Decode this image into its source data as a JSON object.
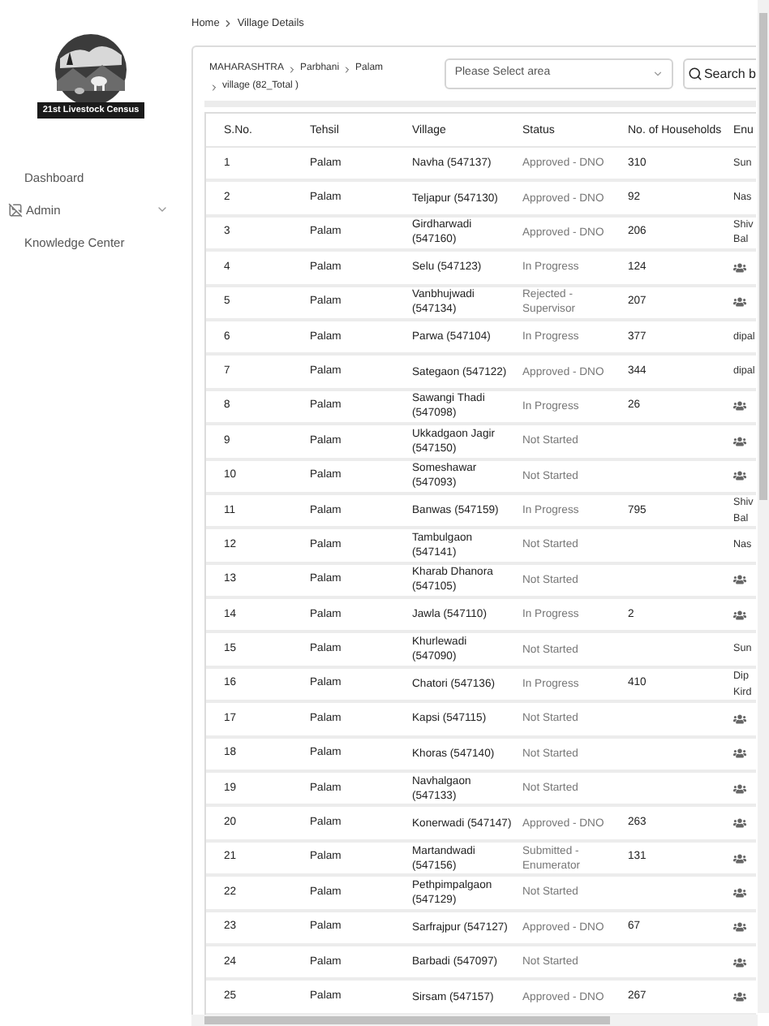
{
  "sidebar": {
    "logo_caption": "21st Livestock Census",
    "items": [
      {
        "label": "Dashboard",
        "kind": "plain",
        "selected": false
      },
      {
        "label": "Admin",
        "kind": "group",
        "selected": false,
        "expanded": false
      },
      {
        "label": "Knowledge Center",
        "kind": "plain",
        "selected": false
      }
    ]
  },
  "breadcrumb": [
    "Home",
    "Village Details"
  ],
  "location": {
    "path": [
      "MAHARASHTRA",
      "Parbhani",
      "Palam",
      "village (82_Total )"
    ]
  },
  "area_select": {
    "placeholder": "Please Select area"
  },
  "search_button": "Search b",
  "table": {
    "columns": [
      "S.No.",
      "Tehsil",
      "Village",
      "Status",
      "No. of Households",
      "Enu"
    ],
    "rows": [
      {
        "sno": "1",
        "tehsil": "Palam",
        "village": "Navha (547137)",
        "status": "Approved - DNO",
        "households": "310",
        "enumerator": {
          "kind": "text",
          "lines": [
            "Sun"
          ]
        }
      },
      {
        "sno": "2",
        "tehsil": "Palam",
        "village": "Teljapur (547130)",
        "status": "Approved - DNO",
        "households": "92",
        "enumerator": {
          "kind": "text",
          "lines": [
            "Nas"
          ]
        }
      },
      {
        "sno": "3",
        "tehsil": "Palam",
        "village": "Girdharwadi (547160)",
        "status": "Approved - DNO",
        "households": "206",
        "enumerator": {
          "kind": "text",
          "lines": [
            "Shiv",
            "Bal"
          ]
        }
      },
      {
        "sno": "4",
        "tehsil": "Palam",
        "village": "Selu (547123)",
        "status": "In Progress",
        "households": "124",
        "enumerator": {
          "kind": "icon"
        }
      },
      {
        "sno": "5",
        "tehsil": "Palam",
        "village": "Vanbhujwadi (547134)",
        "status": "Rejected - Supervisor",
        "households": "207",
        "enumerator": {
          "kind": "icon"
        }
      },
      {
        "sno": "6",
        "tehsil": "Palam",
        "village": "Parwa (547104)",
        "status": "In Progress",
        "households": "377",
        "enumerator": {
          "kind": "text",
          "lines": [
            "dipal"
          ]
        }
      },
      {
        "sno": "7",
        "tehsil": "Palam",
        "village": "Sategaon (547122)",
        "status": "Approved - DNO",
        "households": "344",
        "enumerator": {
          "kind": "text",
          "lines": [
            "dipal"
          ]
        }
      },
      {
        "sno": "8",
        "tehsil": "Palam",
        "village": "Sawangi Thadi (547098)",
        "status": "In Progress",
        "households": "26",
        "enumerator": {
          "kind": "icon"
        }
      },
      {
        "sno": "9",
        "tehsil": "Palam",
        "village": "Ukkadgaon Jagir (547150)",
        "status": "Not Started",
        "enumerator": {
          "kind": "icon"
        }
      },
      {
        "sno": "10",
        "tehsil": "Palam",
        "village": "Someshawar (547093)",
        "status": "Not Started",
        "enumerator": {
          "kind": "icon"
        }
      },
      {
        "sno": "11",
        "tehsil": "Palam",
        "village": "Banwas (547159)",
        "status": "In Progress",
        "households": "795",
        "enumerator": {
          "kind": "text",
          "lines": [
            "Shiv",
            "Bal"
          ]
        }
      },
      {
        "sno": "12",
        "tehsil": "Palam",
        "village": "Tambulgaon (547141)",
        "status": "Not Started",
        "enumerator": {
          "kind": "text",
          "lines": [
            "Nas"
          ]
        }
      },
      {
        "sno": "13",
        "tehsil": "Palam",
        "village": "Kharab Dhanora (547105)",
        "status": "Not Started",
        "enumerator": {
          "kind": "icon"
        }
      },
      {
        "sno": "14",
        "tehsil": "Palam",
        "village": "Jawla (547110)",
        "status": "In Progress",
        "households": "2",
        "enumerator": {
          "kind": "icon"
        }
      },
      {
        "sno": "15",
        "tehsil": "Palam",
        "village": "Khurlewadi (547090)",
        "status": "Not Started",
        "enumerator": {
          "kind": "text",
          "lines": [
            "Sun"
          ]
        }
      },
      {
        "sno": "16",
        "tehsil": "Palam",
        "village": "Chatori (547136)",
        "status": "In Progress",
        "households": "410",
        "enumerator": {
          "kind": "text",
          "lines": [
            "Dip",
            "Kird"
          ]
        }
      },
      {
        "sno": "17",
        "tehsil": "Palam",
        "village": "Kapsi (547115)",
        "status": "Not Started",
        "enumerator": {
          "kind": "icon"
        }
      },
      {
        "sno": "18",
        "tehsil": "Palam",
        "village": "Khoras (547140)",
        "status": "Not Started",
        "enumerator": {
          "kind": "icon"
        }
      },
      {
        "sno": "19",
        "tehsil": "Palam",
        "village": "Navhalgaon (547133)",
        "status": "Not Started",
        "enumerator": {
          "kind": "icon"
        }
      },
      {
        "sno": "20",
        "tehsil": "Palam",
        "village": "Konerwadi (547147)",
        "status": "Approved - DNO",
        "households": "263",
        "enumerator": {
          "kind": "icon"
        }
      },
      {
        "sno": "21",
        "tehsil": "Palam",
        "village": "Martandwadi (547156)",
        "status": "Submitted - Enumerator",
        "households": "131",
        "enumerator": {
          "kind": "icon"
        }
      },
      {
        "sno": "22",
        "tehsil": "Palam",
        "village": "Pethpimpalgaon (547129)",
        "status": "Not Started",
        "enumerator": {
          "kind": "icon"
        }
      },
      {
        "sno": "23",
        "tehsil": "Palam",
        "village": "Sarfrajpur (547127)",
        "status": "Approved - DNO",
        "households": "67",
        "enumerator": {
          "kind": "icon"
        }
      },
      {
        "sno": "24",
        "tehsil": "Palam",
        "village": "Barbadi (547097)",
        "status": "Not Started",
        "enumerator": {
          "kind": "icon"
        }
      },
      {
        "sno": "25",
        "tehsil": "Palam",
        "village": "Sirsam (547157)",
        "status": "Approved - DNO",
        "households": "267",
        "enumerator": {
          "kind": "icon"
        }
      }
    ]
  }
}
